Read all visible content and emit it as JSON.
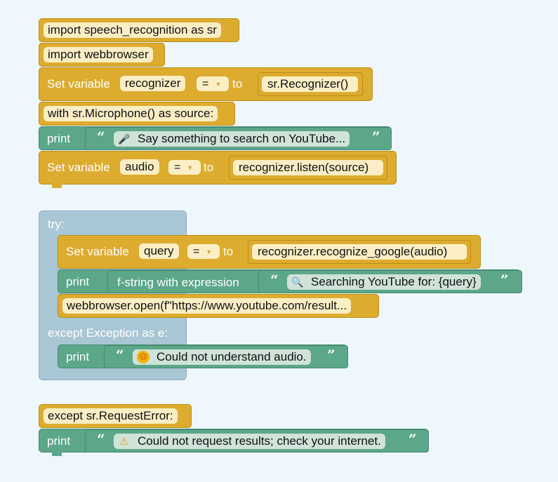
{
  "blocks": {
    "import_sr": "import speech_recognition as sr",
    "import_wb": "import webbrowser",
    "set_word": "Set variable",
    "to_word": "to",
    "eq_sym": "=",
    "var_recognizer": "recognizer",
    "call_recognizer": "sr.Recognizer()",
    "with_mic": "with sr.Microphone() as source:",
    "print_word": "print",
    "say_text": "Say something to search on YouTube...",
    "var_audio": "audio",
    "call_listen": "recognizer.listen(source)",
    "try_label": "try:",
    "var_query": "query",
    "call_google": "recognizer.recognize_google(audio)",
    "fstring_label": "f-string with expression",
    "searching_text": "Searching YouTube for: {query}",
    "webbrowser_call": "webbrowser.open(f\"https://www.youtube.com/result...",
    "except_exc": "except Exception as e:",
    "not_understand": "Could not understand audio.",
    "except_req": "except sr.RequestError:",
    "req_error_text": "Could not request results; check your internet."
  },
  "quotes": {
    "open": "“",
    "close": "”"
  },
  "icons": {
    "mic": "microphone-icon",
    "search": "magnifier-icon",
    "confused": "confused-face-icon",
    "warning": "warning-icon"
  },
  "colors": {
    "background": "#eef7fd",
    "variable_block": "#ddac2e",
    "print_block": "#5ca68a",
    "try_block": "#a9c6d4",
    "field": "#fbeec5"
  }
}
